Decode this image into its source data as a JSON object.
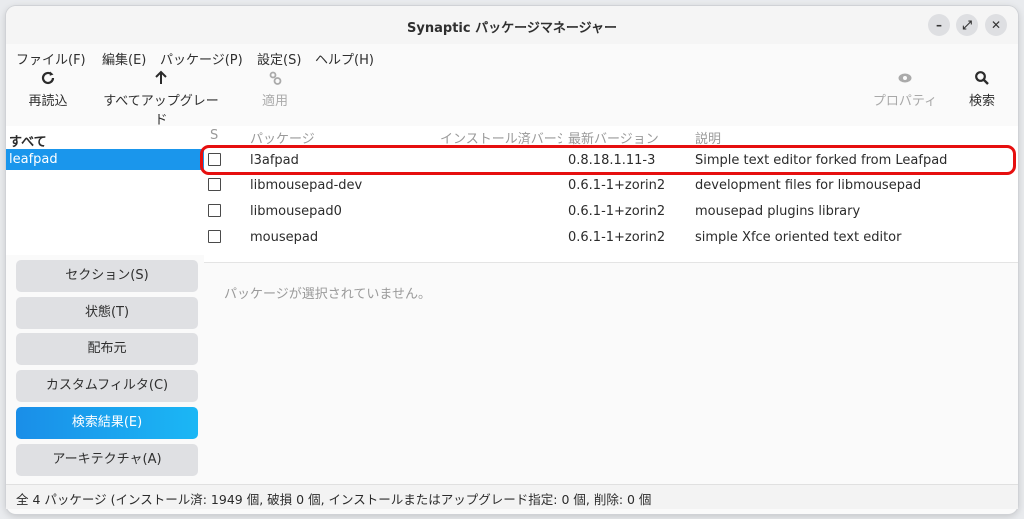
{
  "window": {
    "title": "Synaptic パッケージマネージャー",
    "controls": {
      "minimize": "–",
      "maximize": "⤢",
      "close": "✕"
    }
  },
  "menubar": [
    "ファイル(F)",
    "編集(E)",
    "パッケージ(P)",
    "設定(S)",
    "ヘルプ(H)"
  ],
  "toolbar": {
    "reload": {
      "label": "再読込",
      "icon": "reload-icon"
    },
    "upgrade_all": {
      "label": "すべてアップグレード",
      "icon": "up-arrow-icon"
    },
    "apply": {
      "label": "適用",
      "icon": "gears-icon",
      "disabled": true
    },
    "properties": {
      "label": "プロパティ",
      "icon": "eye-icon",
      "disabled": true
    },
    "search": {
      "label": "検索",
      "icon": "search-icon"
    }
  },
  "left_panel": {
    "header": "すべて",
    "items": [
      "leafpad"
    ],
    "selected": "leafpad"
  },
  "filter_buttons": [
    {
      "label": "セクション(S)"
    },
    {
      "label": "状態(T)"
    },
    {
      "label": "配布元"
    },
    {
      "label": "カスタムフィルタ(C)"
    },
    {
      "label": "検索結果(E)",
      "active": true
    },
    {
      "label": "アーキテクチャ(A)"
    }
  ],
  "package_table": {
    "columns": [
      "S",
      "パッケージ",
      "インストール済バージ",
      "最新バージョン",
      "説明"
    ],
    "rows": [
      {
        "name": "l3afpad",
        "installed": "",
        "latest": "0.8.18.1.11-3",
        "description": "Simple text editor forked from Leafpad",
        "checked": false,
        "highlighted": true
      },
      {
        "name": "libmousepad-dev",
        "installed": "",
        "latest": "0.6.1-1+zorin2",
        "description": "development files for libmousepad",
        "checked": false
      },
      {
        "name": "libmousepad0",
        "installed": "",
        "latest": "0.6.1-1+zorin2",
        "description": "mousepad plugins library",
        "checked": false
      },
      {
        "name": "mousepad",
        "installed": "",
        "latest": "0.6.1-1+zorin2",
        "description": "simple Xfce oriented text editor",
        "checked": false
      }
    ]
  },
  "details": {
    "empty_text": "パッケージが選択されていません。"
  },
  "status_bar": "全 4 パッケージ (インストール済: 1949 個, 破損 0 個, インストールまたはアップグレード指定: 0 個, 削除: 0 個",
  "colors": {
    "accent": "#1a96ec",
    "highlight_border": "#e60f0f"
  }
}
